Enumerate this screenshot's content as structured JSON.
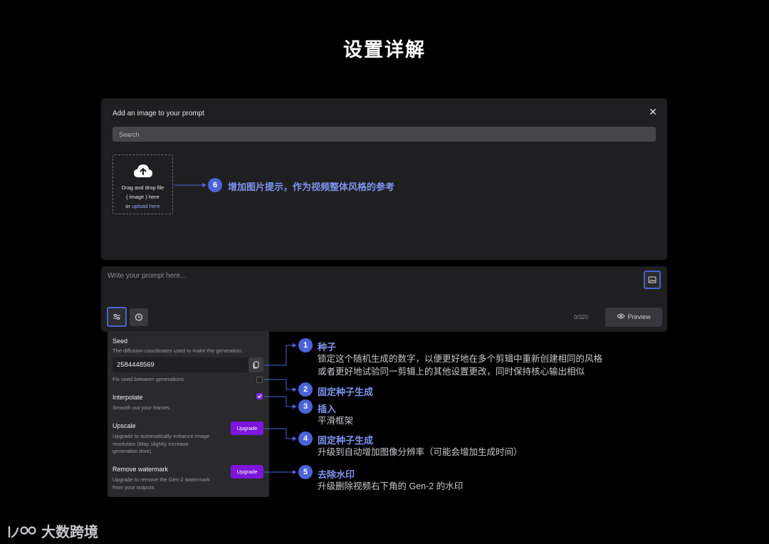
{
  "page_title": "设置详解",
  "dialog": {
    "title": "Add an image to your prompt",
    "search_placeholder": "Search",
    "dropzone": {
      "line1": "Drag and drop file",
      "line2": "( image ) here",
      "line3_prefix": "or ",
      "line3_link": "upload here"
    }
  },
  "prompt": {
    "placeholder": "Write your prompt here...",
    "counter": "0/320",
    "preview_label": "Preview"
  },
  "settings": {
    "seed": {
      "label": "Seed",
      "description": "The diffusion coordinates used to make the generation.",
      "value": "2584448569",
      "fix_label": "Fix seed between generations",
      "fix_checked": false
    },
    "interpolate": {
      "label": "Interpolate",
      "description": "Smooth out your frames.",
      "checked": true
    },
    "upscale": {
      "label": "Upscale",
      "description_lines": [
        "Upgrade to automatically enhance image",
        "resolution (May slightly increase",
        "generation time)."
      ],
      "button_label": "Upgrade"
    },
    "watermark": {
      "label": "Remove watermark",
      "description_lines": [
        "Upgrade to remove the Gen-2 watermark",
        "from your outputs."
      ],
      "button_label": "Upgrade"
    }
  },
  "annotations": [
    {
      "number": "1",
      "title": "种子",
      "desc_lines": [
        "锁定这个随机生成的数字，以便更好地在多个剪辑中重新创建相同的风格",
        "或者更好地试验同一剪辑上的其他设置更改，同时保持核心输出相似"
      ]
    },
    {
      "number": "2",
      "title": "固定种子生成",
      "desc_lines": []
    },
    {
      "number": "3",
      "title": "插入",
      "desc_lines": [
        "平滑框架"
      ]
    },
    {
      "number": "4",
      "title": "固定种子生成",
      "desc_lines": [
        "升级到自动增加图像分辨率（可能会增加生成时间）"
      ]
    },
    {
      "number": "5",
      "title": "去除水印",
      "desc_lines": [
        "升级删除视频右下角的 Gen-2 的水印"
      ]
    },
    {
      "number": "6",
      "title": "增加图片提示，作为视频整体风格的参考",
      "desc_lines": []
    }
  ],
  "logo": {
    "text": "大数跨境",
    "mark": "100"
  },
  "colors": {
    "accent": "#4b63d8",
    "upgrade": "#7d16dc",
    "panel": "#1f1f21",
    "annotation_title": "#7e93ee"
  }
}
